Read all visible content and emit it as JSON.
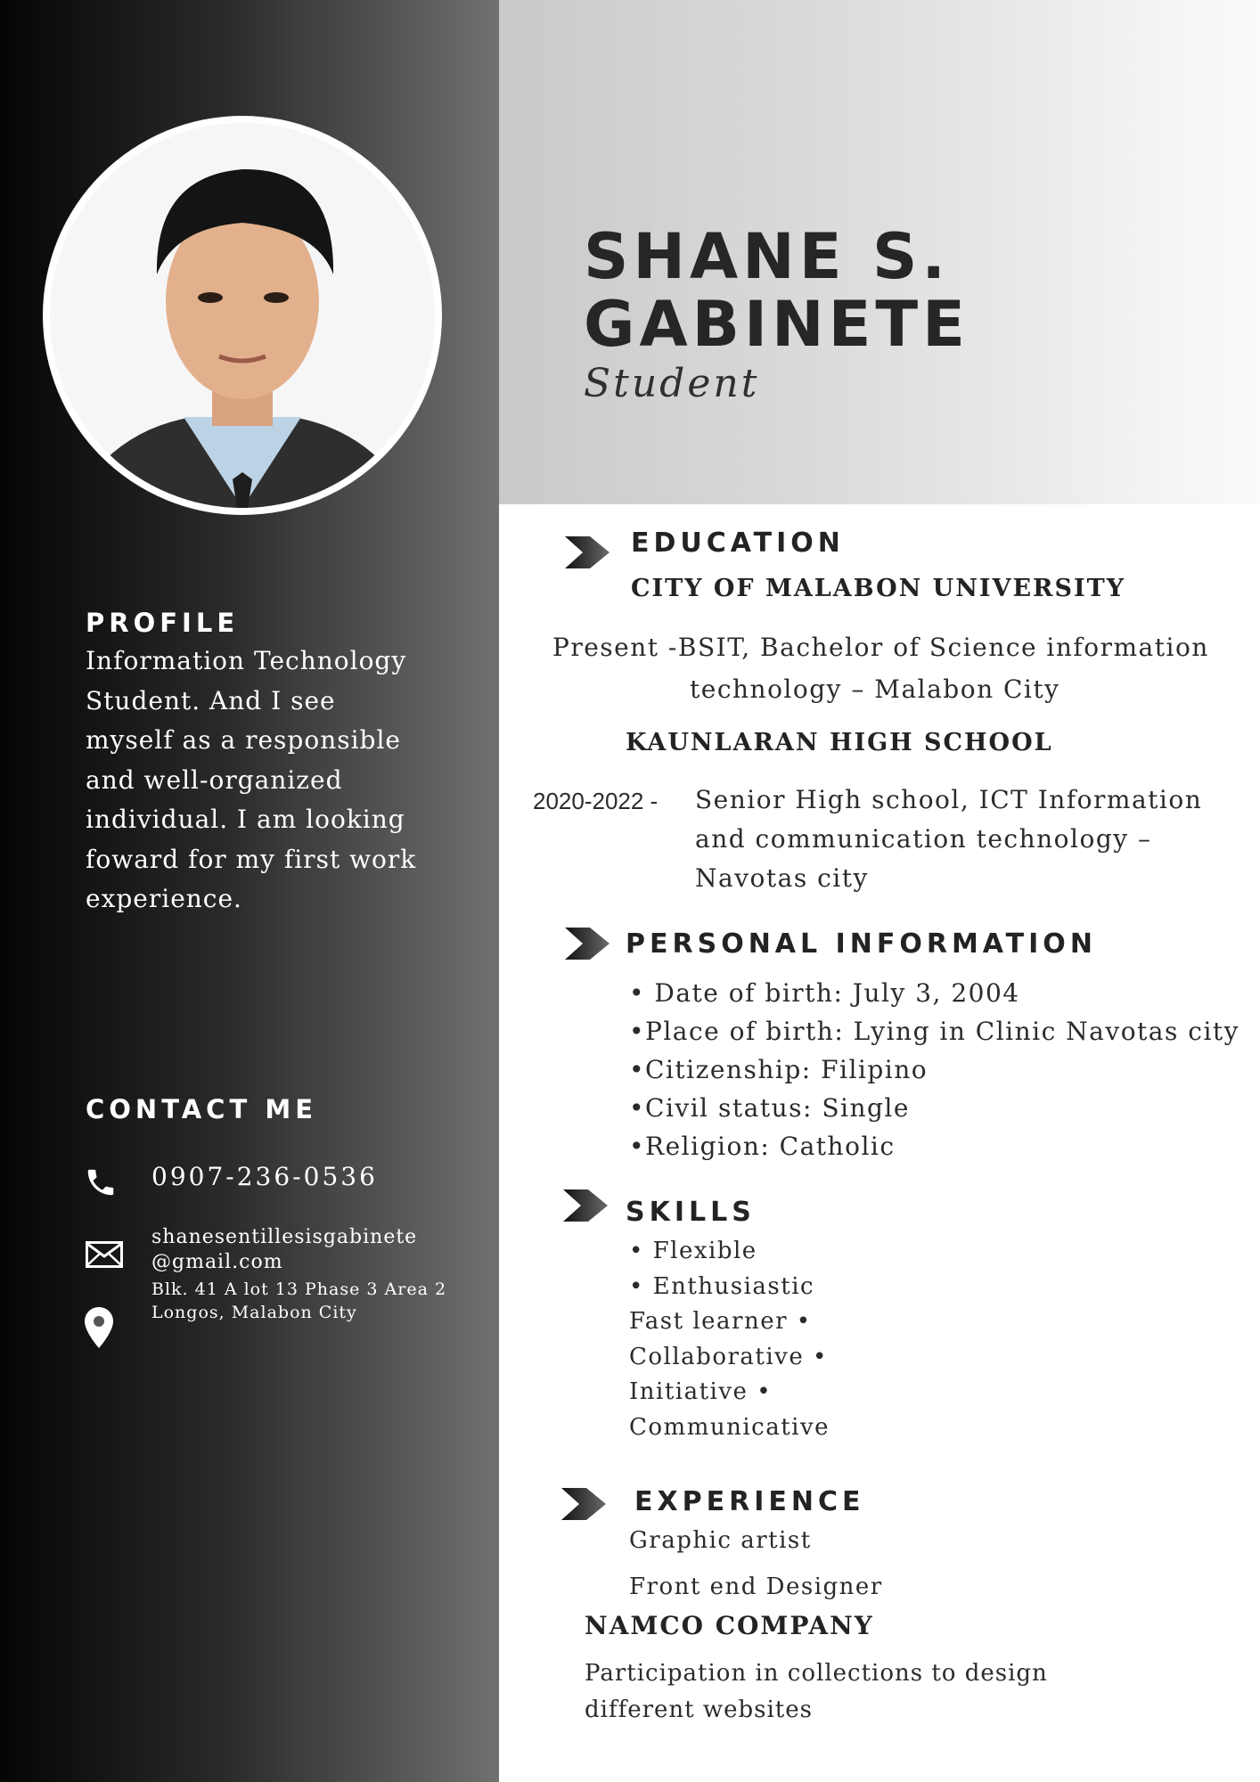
{
  "header": {
    "name_line1": "SHANE S.",
    "name_line2": "GABINETE",
    "title": "Student"
  },
  "profile": {
    "heading": "PROFILE",
    "text": "Information Technology Student. And I see myself as a responsible and well-organized individual. I am looking foward for my first work experience."
  },
  "contact": {
    "heading": "CONTACT ME",
    "phone": "0907-236-0536",
    "email_line1": "shanesentillesisgabinete",
    "email_line2": "@gmail.com",
    "address_line1": "Blk. 41 A lot 13 Phase 3 Area 2",
    "address_line2": "Longos, Malabon City",
    "icons": [
      "phone-icon",
      "envelope-icon",
      "location-pin-icon"
    ]
  },
  "education": {
    "heading": "EDUCATION",
    "school1": "CITY OF MALABON UNIVERSITY",
    "school1_line1": "Present -BSIT, Bachelor of Science information",
    "school1_line2": "technology – Malabon City",
    "school2": "KAUNLARAN HIGH SCHOOL",
    "school2_years": "2020-2022 -",
    "school2_line1": "Senior High school, ICT Information",
    "school2_line2": "and communication technology –",
    "school2_line3": "Navotas city"
  },
  "personal": {
    "heading": "PERSONAL INFORMATION",
    "items": [
      "• Date of birth: July 3, 2004",
      "•Place of birth: Lying in Clinic Navotas city",
      "•Citizenship: Filipino",
      "•Civil status: Single",
      "•Religion: Catholic"
    ]
  },
  "skills": {
    "heading": "SKILLS",
    "lines": [
      "• Flexible",
      "• Enthusiastic",
      "Fast learner •",
      "Collaborative •",
      "Initiative •",
      "Communicative"
    ]
  },
  "experience": {
    "heading": "EXPERIENCE",
    "role1": "Graphic artist",
    "role2": "Front end Designer",
    "company": "NAMCO COMPANY",
    "desc_line1": "Participation in collections to design",
    "desc_line2": "different websites"
  },
  "colors": {
    "sidebar_dark": "#050505",
    "sidebar_light": "#707070",
    "header_band": "#d6d6d6",
    "heading_text": "#232323"
  }
}
